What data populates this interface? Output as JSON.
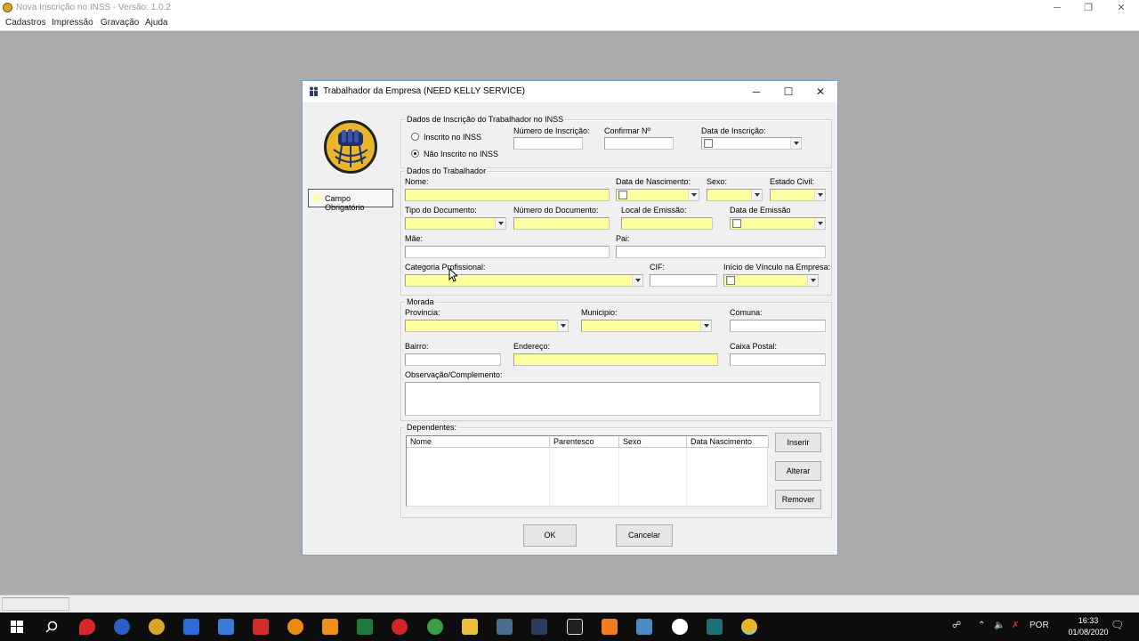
{
  "app": {
    "title": "Nova Inscrição no INSS - Versão: 1.0.2",
    "menu": [
      "Cadastros",
      "Impressão",
      "Gravação",
      "Ajuda"
    ]
  },
  "dialog": {
    "title": "Trabalhador da Empresa (NEED KELLY SERVICE)",
    "legend": "Campo Obrigatório",
    "colors": {
      "required": "#ffff9d",
      "logo": "#e9b62b"
    },
    "inscricao": {
      "group": "Dados de Inscrição do Trabalhador no INSS",
      "radio_inscrito": "Inscrito no INSS",
      "radio_nao_inscrito": "Não Inscrito no INSS",
      "selected": "Não Inscrito no INSS",
      "numero_label": "Número de Inscrição:",
      "confirmar_label": "Confirmar Nº",
      "data_label": "Data de Inscrição:"
    },
    "trabalhador": {
      "group": "Dados do Trabalhador",
      "nome": "Nome:",
      "data_nascimento": "Data de Nascimento:",
      "sexo": "Sexo:",
      "estado_civil": "Estado Civil:",
      "tipo_documento": "Tipo do Documento:",
      "numero_documento": "Número do Documento:",
      "local_emissao": "Local de Emissão:",
      "data_emissao": "Data de Emissão",
      "mae": "Mãe:",
      "pai": "Pai:",
      "categoria": "Categoria Profissional:",
      "cif": "CIF:",
      "inicio_vinculo": "Início de Vínculo na Empresa:"
    },
    "morada": {
      "group": "Morada",
      "provincia": "Provincia:",
      "municipio": "Municipio:",
      "comuna": "Comuna:",
      "bairro": "Bairro:",
      "endereco": "Endereço:",
      "caixa_postal": "Caixa Postal:",
      "observacao": "Observação/Complemento:"
    },
    "dependentes": {
      "group": "Dependentes:",
      "columns": [
        "Nome",
        "Parentesco",
        "Sexo",
        "Data Nascimento"
      ],
      "buttons": {
        "inserir": "Inserir",
        "alterar": "Alterar",
        "remover": "Remover"
      }
    },
    "ok": "OK",
    "cancelar": "Cancelar"
  },
  "taskbar": {
    "language": "POR",
    "time": "16:33",
    "date": "01/08/2020"
  }
}
